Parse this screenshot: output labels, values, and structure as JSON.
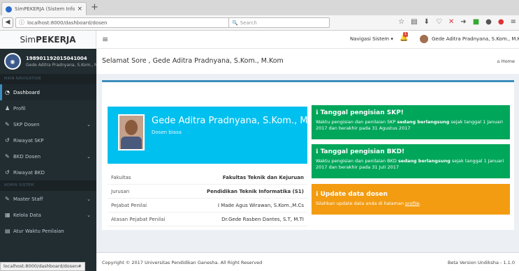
{
  "browser": {
    "tab_title": "SimPEKERJA (Sistem Inform",
    "tab_close": "×",
    "new_tab": "+",
    "url": "localhost:8000/dashboard/dosen",
    "search_placeholder": "Search"
  },
  "app": {
    "brand_prefix": "Sim",
    "brand_bold": "PEKERJA"
  },
  "sidebar": {
    "user_id": "198901192015041004",
    "user_name": "Gede Aditra Pradnyana, S.Kom., M.",
    "header_main": "MAIN NAVIGATION",
    "header_admin": "ADMIN SISTEM",
    "items": [
      {
        "label": "Dashboard",
        "icon": "dashboard-icon"
      },
      {
        "label": "Profil",
        "icon": "user-icon"
      },
      {
        "label": "SKP Dosen",
        "icon": "edit-icon"
      },
      {
        "label": "Riwayat SKP",
        "icon": "history-icon"
      },
      {
        "label": "BKD Dosen",
        "icon": "edit-icon"
      },
      {
        "label": "Riwayat BKD",
        "icon": "history-icon"
      },
      {
        "label": "Master Staff",
        "icon": "edit-icon"
      },
      {
        "label": "Kelola Data",
        "icon": "table-icon"
      },
      {
        "label": "Atur Waktu Penilaian",
        "icon": "calendar-icon"
      }
    ]
  },
  "topbar": {
    "nav_system": "Navigasi Sistem",
    "notif_count": "1",
    "user_name": "Gede Aditra Pradnyana, S.Kom., M.Kom"
  },
  "main": {
    "greeting": "Selamat Sore , Gede Aditra Pradnyana, S.Kom., M.Kom",
    "breadcrumb_home": "Home",
    "profile": {
      "name": "Gede Aditra Pradnyana, S.Kom., M.Kom",
      "role": "Dosen biasa"
    },
    "info": [
      {
        "label": "Fakultas",
        "value": "Fakultas Teknik dan Kejuruan",
        "bold": true
      },
      {
        "label": "Jurusan",
        "value": "Pendidikan Teknik Informatika (S1)",
        "bold": true
      },
      {
        "label": "Pejabat Penilai",
        "value": "I Made Agus Wirawan, S.Kom.,M.Cs",
        "bold": false
      },
      {
        "label": "Atasan Pejabat Penilai",
        "value": "Dr.Gede Rasben Dantes, S.T, M.TI",
        "bold": false
      }
    ],
    "callouts": {
      "skp": {
        "title": "Tanggal pengisian SKP!",
        "text1": "Waktu pengisian dan penilaian SKP ",
        "bold": "sedang berlangsung",
        "text2": " sejak tanggal 1 Januari 2017 dan berakhir pada 31 Agustus 2017"
      },
      "bkd": {
        "title": "Tanggal pengisian BKD!",
        "text1": "Waktu pengisian dan penilaian BKD ",
        "bold": "sedang berlangsung",
        "text2": " sejak tanggal 1 Januari 2017 dan berakhir pada 31 Juli 2017"
      },
      "update": {
        "title": "Update data dosen",
        "text1": "Silahkan update data anda di halaman ",
        "link": "profile",
        "text2": "."
      }
    }
  },
  "footer": {
    "copyright": "Copyright © 2017 Universitas Pendidikan Ganesha. All Right Reserved",
    "version": "Beta Version Undiksha - 1.1.0"
  },
  "status_url": "localhost:8000/dashboard/dosen#"
}
